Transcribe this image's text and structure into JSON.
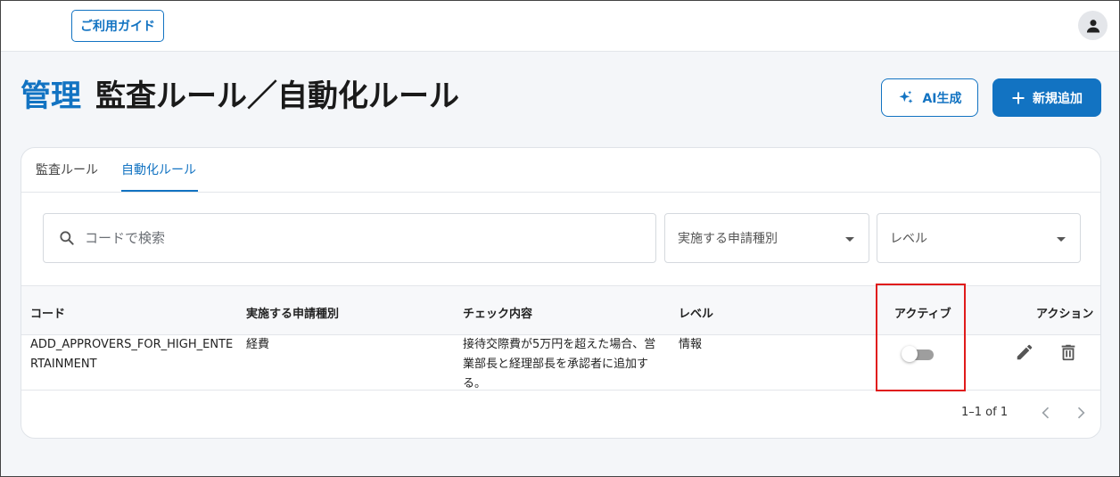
{
  "header": {
    "guide_label": "ご利用ガイド",
    "avatar_icon": "account-circle-icon"
  },
  "page": {
    "title_prefix": "管理",
    "title_main": "監査ルール／自動化ルール",
    "ai_button_label": "AI生成",
    "new_button_label": "新規追加"
  },
  "tabs": [
    {
      "label": "監査ルール",
      "active": false
    },
    {
      "label": "自動化ルール",
      "active": true
    }
  ],
  "filters": {
    "search_placeholder": "コードで検索",
    "application_type_label": "実施する申請種別",
    "level_label": "レベル"
  },
  "table": {
    "headers": [
      "コード",
      "実施する申請種別",
      "チェック内容",
      "レベル",
      "アクティブ",
      "アクション"
    ],
    "rows": [
      {
        "code": "ADD_APPROVERS_FOR_HIGH_ENTERTAINMENT",
        "application_type": "経費",
        "check_content": "接待交際費が5万円を超えた場合、営業部長と経理部長を承認者に追加する。",
        "level": "情報",
        "active": false
      }
    ]
  },
  "pagination": {
    "range_text": "1–1 of 1"
  },
  "colors": {
    "accent": "#1273c2",
    "highlight": "#e01b1b"
  }
}
